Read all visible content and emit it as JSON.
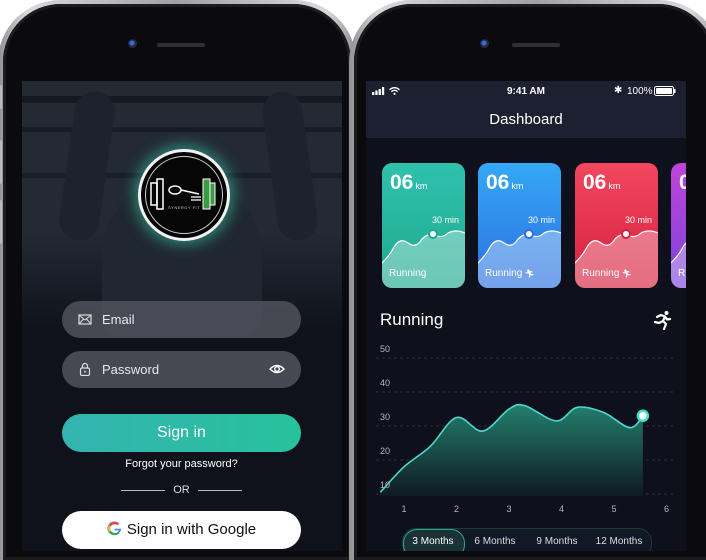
{
  "login": {
    "logo_text": "SYNERGY FIT",
    "email_placeholder": "Email",
    "password_placeholder": "Password",
    "signin_label": "Sign in",
    "forgot_label": "Forgot your password?",
    "or_label": "OR",
    "google_label": "Sign in with Google",
    "icons": {
      "email": "envelope-icon",
      "password": "lock-icon",
      "reveal": "eye-icon",
      "google": "google-g-icon"
    }
  },
  "dashboard": {
    "status": {
      "time": "9:41 AM",
      "battery": "100%"
    },
    "title": "Dashboard",
    "cards": [
      {
        "value": "06",
        "unit": "km",
        "duration": "30 min",
        "label": "Running",
        "show_icon": false,
        "color_top": "#2fc1ad",
        "color_bottom": "#20a98f"
      },
      {
        "value": "06",
        "unit": "km",
        "duration": "30 min",
        "label": "Running",
        "show_icon": true,
        "color_top": "#35a8f5",
        "color_bottom": "#2c6fe0"
      },
      {
        "value": "06",
        "unit": "km",
        "duration": "30 min",
        "label": "Running",
        "show_icon": true,
        "color_top": "#f2475f",
        "color_bottom": "#d5203f"
      },
      {
        "value": "0",
        "unit": "",
        "duration": "",
        "label": "R",
        "show_icon": false,
        "color_top": "#c044d8",
        "color_bottom": "#7a44dd"
      }
    ],
    "section_title": "Running",
    "ranges": [
      "3 Months",
      "6 Months",
      "9 Months",
      "12 Months"
    ],
    "selected_range": "3 Months",
    "accent": "#3fe0c8"
  },
  "chart_data": {
    "type": "area",
    "title": "Running",
    "x": [
      0.55,
      1.0,
      1.5,
      2.0,
      2.5,
      3.0,
      3.3,
      3.9,
      4.3,
      4.8,
      5.3,
      5.55
    ],
    "values": [
      10.5,
      18,
      24,
      32.5,
      28.5,
      35,
      36,
      31.5,
      35.5,
      34,
      29.5,
      33
    ],
    "x_ticks": [
      "1",
      "2",
      "3",
      "4",
      "5",
      "6"
    ],
    "y_ticks": [
      "10",
      "20",
      "30",
      "40",
      "50"
    ],
    "xlim": [
      0.55,
      6
    ],
    "ylim": [
      10,
      50
    ],
    "grid": true,
    "highlight_point_index": 11,
    "xlabel": "",
    "ylabel": ""
  }
}
